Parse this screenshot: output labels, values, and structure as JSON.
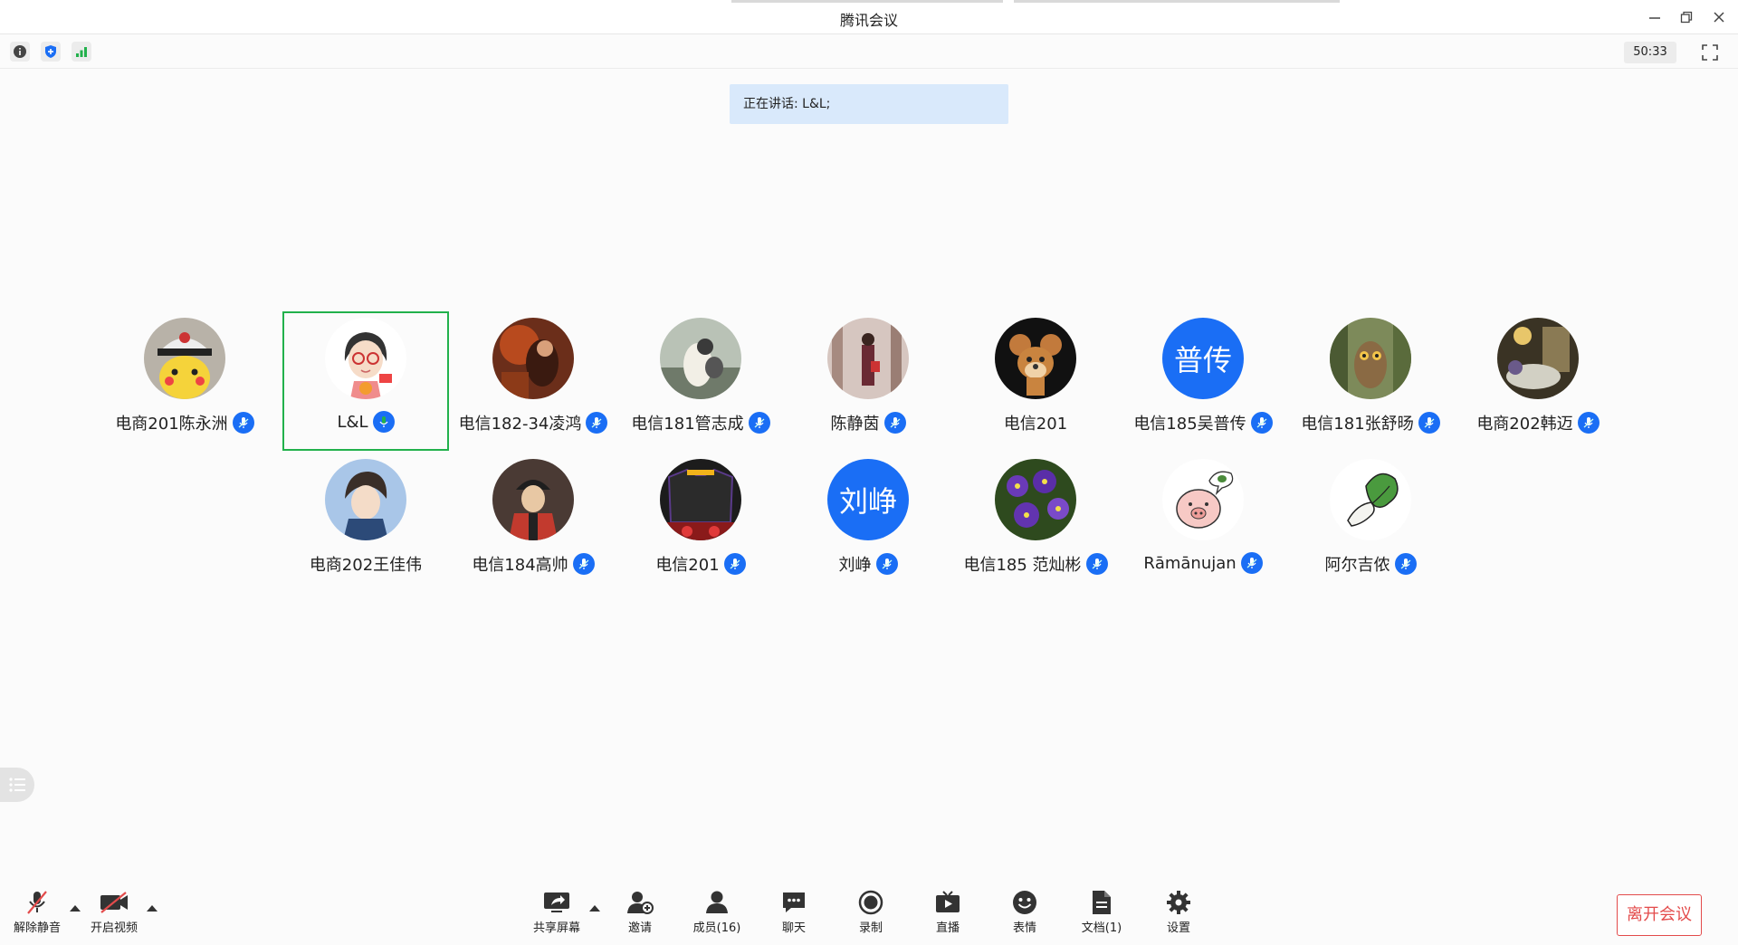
{
  "window": {
    "title": "腾讯会议",
    "timer": "50:33"
  },
  "speaking": {
    "text": "正在讲话: L&L;"
  },
  "participants": [
    {
      "name": "电商201陈永洲",
      "avatar": "pikachu-avatar",
      "mic": "on"
    },
    {
      "name": "L&L",
      "avatar": "cartoon-girl-avatar",
      "mic": "speaking",
      "active": true
    },
    {
      "name": "电信182-34凌鸿",
      "avatar": "photo-avatar",
      "mic": "on"
    },
    {
      "name": "电信181管志成",
      "avatar": "photo-avatar",
      "mic": "on"
    },
    {
      "name": "陈静茵",
      "avatar": "photo-avatar",
      "mic": "on"
    },
    {
      "name": "电信201",
      "avatar": "jerry-avatar",
      "mic": "none"
    },
    {
      "name": "电信185吴普传",
      "avatar_text": "普传",
      "mic": "on"
    },
    {
      "name": "电信181张舒旸",
      "avatar": "owl-avatar",
      "mic": "on"
    },
    {
      "name": "电商202韩迈",
      "avatar": "photo-avatar",
      "mic": "on"
    },
    {
      "name": "电商202王佳伟",
      "avatar": "anime-avatar",
      "mic": "none"
    },
    {
      "name": "电信184高帅",
      "avatar": "anime-avatar",
      "mic": "on"
    },
    {
      "name": "电信201",
      "avatar": "jersey-avatar",
      "mic": "on"
    },
    {
      "name": "刘峥",
      "avatar_text": "刘峥",
      "mic": "on"
    },
    {
      "name": "电信185 范灿彬",
      "avatar": "flowers-avatar",
      "mic": "on"
    },
    {
      "name": "Rāmānujan",
      "avatar": "pig-avatar",
      "mic": "on"
    },
    {
      "name": "阿尔吉侬",
      "avatar": "cabbage-avatar",
      "mic": "on"
    }
  ],
  "toolbar": {
    "unmute": "解除静音",
    "start_video": "开启视频",
    "share_screen": "共享屏幕",
    "invite": "邀请",
    "members": "成员(16)",
    "chat": "聊天",
    "record": "录制",
    "live": "直播",
    "reactions": "表情",
    "docs": "文档(1)",
    "settings": "设置",
    "leave": "离开会议"
  },
  "colors": {
    "accent_blue": "#1a6ef5",
    "active_green": "#22b14c",
    "leave_red": "#e34b4b",
    "speaking_bg": "#d9e9fb"
  }
}
